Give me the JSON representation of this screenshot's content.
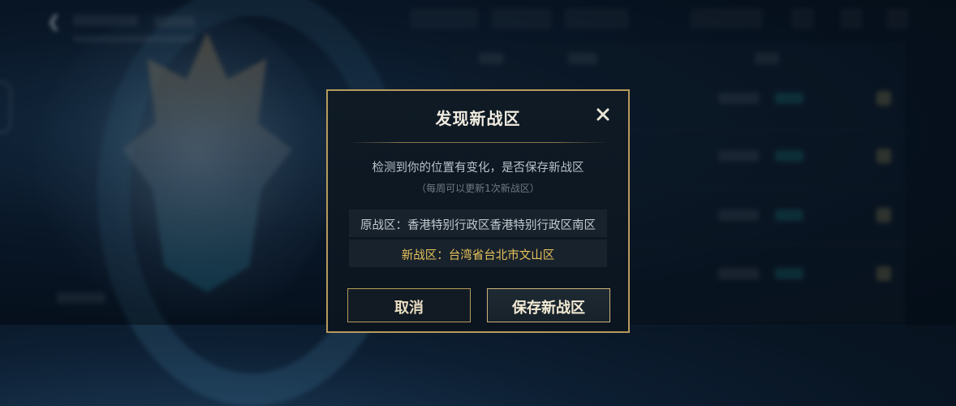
{
  "dialog": {
    "title": "发现新战区",
    "message": "检测到你的位置有变化，是否保存新战区",
    "note": "（每周可以更新1次新战区）",
    "old_region": "原战区：香港特别行政区香港特别行政区南区",
    "new_region": "新战区：台湾省台北市文山区",
    "cancel_label": "取消",
    "save_label": "保存新战区"
  },
  "colors": {
    "border_gold": "#b79a5c",
    "highlight": "#e7c25a",
    "background": "#0b1520"
  },
  "icons": {
    "close": "close-icon",
    "back": "back-arrow-icon"
  }
}
